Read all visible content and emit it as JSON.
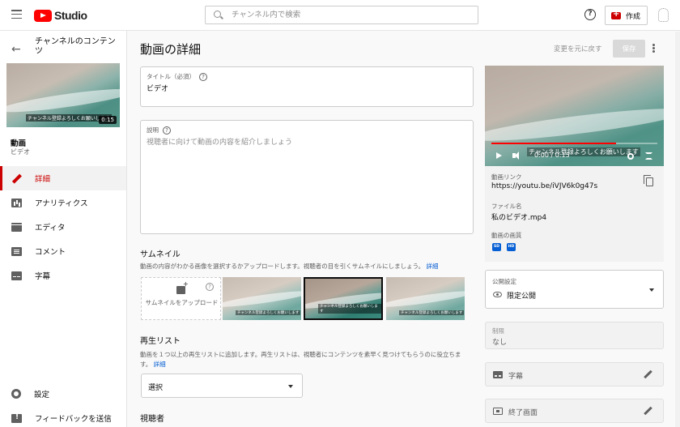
{
  "topbar": {
    "logo_text": "Studio",
    "search_placeholder": "チャンネル内で検索",
    "help": "?",
    "create_label": "作成"
  },
  "sidebar": {
    "title": "チャンネルのコンテンツ",
    "thumbnail_caption": "チャンネル登録よろしくお願いします",
    "thumbnail_duration": "0:15",
    "video_label": "動画",
    "video_title": "ビデオ",
    "items": [
      {
        "label": "詳細",
        "icon": "pencil-icon",
        "active": true
      },
      {
        "label": "アナリティクス",
        "icon": "analytics-icon"
      },
      {
        "label": "エディタ",
        "icon": "editor-icon"
      },
      {
        "label": "コメント",
        "icon": "comment-icon"
      },
      {
        "label": "字幕",
        "icon": "subtitles-icon"
      }
    ],
    "bottom_items": [
      {
        "label": "設定",
        "icon": "gear-icon"
      },
      {
        "label": "フィードバックを送信",
        "icon": "feedback-icon"
      }
    ]
  },
  "header": {
    "title": "動画の詳細",
    "undo_label": "変更を元に戻す",
    "save_label": "保存"
  },
  "form": {
    "title_label": "タイトル（必須）",
    "title_value": "ビデオ",
    "description_label": "説明",
    "description_placeholder": "視聴者に向けて動画の内容を紹介しましょう",
    "thumbnail_heading": "サムネイル",
    "thumbnail_desc": "動画の内容がわかる画像を選択するかアップロードします。視聴者の目を引くサムネイルにしましょう。",
    "thumbnail_link": "詳細",
    "upload_label": "サムネイルをアップロード",
    "thumbnail_caption": "チャンネル登録よろしくお願いします",
    "playlist_heading": "再生リスト",
    "playlist_desc": "動画を１つ以上の再生リストに追加します。再生リストは、視聴者にコンテンツを素早く見つけてもらうのに役立ちます。",
    "playlist_link": "詳細",
    "playlist_select": "選択",
    "audience_heading": "視聴者"
  },
  "preview": {
    "caption": "チャンネル登録よろしくお願いします",
    "time": "0:00 / 0:15",
    "progress": 0.75,
    "link_label": "動画リンク",
    "link_value": "https://youtu.be/iVJV6k0g47s",
    "file_label": "ファイル名",
    "file_value": "私のビデオ.mp4",
    "quality_label": "動画の画質",
    "quality_badges": [
      "SD",
      "HD"
    ]
  },
  "settings": {
    "visibility_label": "公開設定",
    "visibility_value": "限定公開",
    "restriction_label": "制限",
    "restriction_value": "なし",
    "subtitles_label": "字幕",
    "endscreen_label": "終了画面"
  },
  "colors": {
    "brand_red": "#ff0000",
    "accent_red": "#cc0000",
    "link_blue": "#065fd4"
  }
}
